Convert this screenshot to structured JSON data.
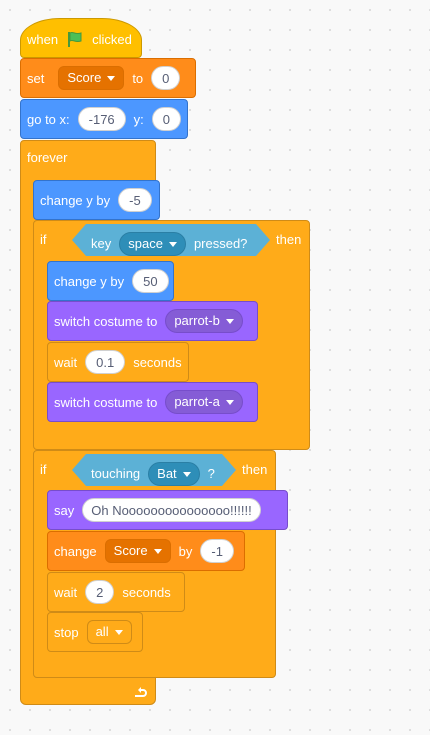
{
  "script": {
    "hat": {
      "when": "when",
      "flag_icon": "green-flag-icon",
      "clicked": "clicked"
    },
    "set": {
      "label": "set",
      "variable": "Score",
      "to": "to",
      "value": "0"
    },
    "goto": {
      "label": "go to x:",
      "x": "-176",
      "y_label": "y:",
      "y": "0"
    },
    "forever": {
      "label": "forever"
    },
    "change_y": {
      "label": "change y by",
      "value": "-5"
    },
    "if1": {
      "if": "if",
      "key": "key",
      "key_value": "space",
      "pressed": "pressed?",
      "then": "then",
      "change_y": {
        "label": "change y by",
        "value": "50"
      },
      "costume1": {
        "label": "switch costume to",
        "value": "parrot-b"
      },
      "wait": {
        "label": "wait",
        "value": "0.1",
        "unit": "seconds"
      },
      "costume2": {
        "label": "switch costume to",
        "value": "parrot-a"
      }
    },
    "if2": {
      "if": "if",
      "touching": "touching",
      "target": "Bat",
      "q": "?",
      "then": "then",
      "say": {
        "label": "say",
        "value": "Oh Nooooooooooooooo!!!!!!"
      },
      "change": {
        "label": "change",
        "variable": "Score",
        "by": "by",
        "value": "-1"
      },
      "wait": {
        "label": "wait",
        "value": "2",
        "unit": "seconds"
      },
      "stop": {
        "label": "stop",
        "value": "all"
      }
    }
  }
}
